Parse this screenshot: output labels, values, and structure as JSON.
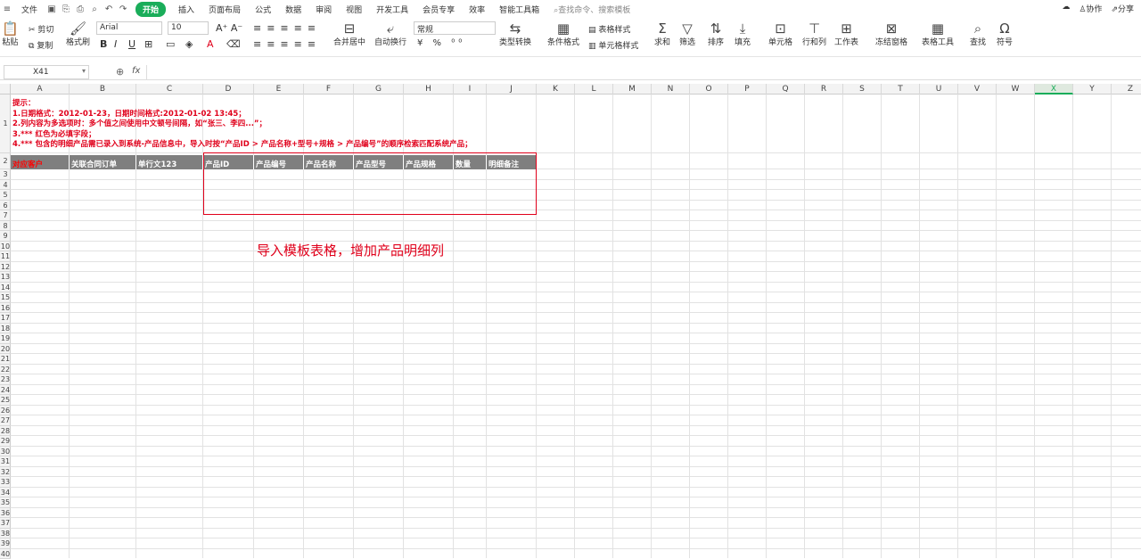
{
  "menu": {
    "file": "文件",
    "tabs": [
      "开始",
      "插入",
      "页面布局",
      "公式",
      "数据",
      "审阅",
      "视图",
      "开发工具",
      "会员专享",
      "效率",
      "智能工具箱"
    ],
    "search": "查找命令、搜索模板",
    "collab": "协作",
    "share": "分享"
  },
  "ribbon": {
    "paste": "粘贴",
    "cut": "剪切",
    "copy": "复制",
    "format_painter": "格式刷",
    "font_name": "Arial",
    "font_size": "10",
    "merge_center": "合并居中",
    "wrap_text": "自动换行",
    "number_format": "常规",
    "type_convert": "类型转换",
    "cond_format": "条件格式",
    "table_style": "表格样式",
    "cell_style": "单元格样式",
    "sum": "求和",
    "filter": "筛选",
    "sort": "排序",
    "fill": "填充",
    "cells": "单元格",
    "row_col": "行和列",
    "worksheet": "工作表",
    "freeze": "冻结窗格",
    "table_tools": "表格工具",
    "find": "查找",
    "symbol": "符号"
  },
  "formula_bar": {
    "cell_ref": "X41",
    "fx": "fx",
    "value": ""
  },
  "grid": {
    "columns": [
      "A",
      "B",
      "C",
      "D",
      "E",
      "F",
      "G",
      "H",
      "I",
      "J",
      "K",
      "L",
      "M",
      "N",
      "O",
      "P",
      "Q",
      "R",
      "S",
      "T",
      "U",
      "V",
      "W",
      "X",
      "Y",
      "Z"
    ],
    "selected_column": "X",
    "rows": [
      "1",
      "2",
      "3",
      "4",
      "5",
      "6",
      "7",
      "8",
      "9",
      "10",
      "11",
      "12",
      "13",
      "14",
      "15",
      "16",
      "17",
      "18",
      "19",
      "20",
      "21",
      "22",
      "23",
      "24",
      "25",
      "26",
      "27",
      "28",
      "29",
      "30",
      "31",
      "32",
      "33",
      "34",
      "35",
      "36",
      "37",
      "38",
      "39",
      "40"
    ],
    "hints": [
      "提示：",
      "1.日期格式：2012-01-23，日期时间格式:2012-01-02 13:45；",
      "2.列内容为多选项时：多个值之间使用中文顿号间隔，如“张三、李四...”；",
      "3.*** 红色为必填字段；",
      "4.*** 包含的明细产品需已录入到系统-产品信息中，导入时按“产品ID > 产品名称+型号+规格 > 产品编号”的顺序检索匹配系统产品；"
    ],
    "headers": [
      {
        "text": "对应客户",
        "required": true
      },
      {
        "text": "关联合同订单",
        "required": false
      },
      {
        "text": "单行文123",
        "required": false
      },
      {
        "text": "产品ID",
        "required": false
      },
      {
        "text": "产品编号",
        "required": false
      },
      {
        "text": "产品名称",
        "required": false
      },
      {
        "text": "产品型号",
        "required": false
      },
      {
        "text": "产品规格",
        "required": false
      },
      {
        "text": "数量",
        "required": false
      },
      {
        "text": "明细备注",
        "required": false
      }
    ],
    "annotation": "导入模板表格，增加产品明细列"
  },
  "colors": {
    "accent": "#1aad5a",
    "required_red": "#e0001b",
    "header_gray": "#7f7f7f"
  }
}
